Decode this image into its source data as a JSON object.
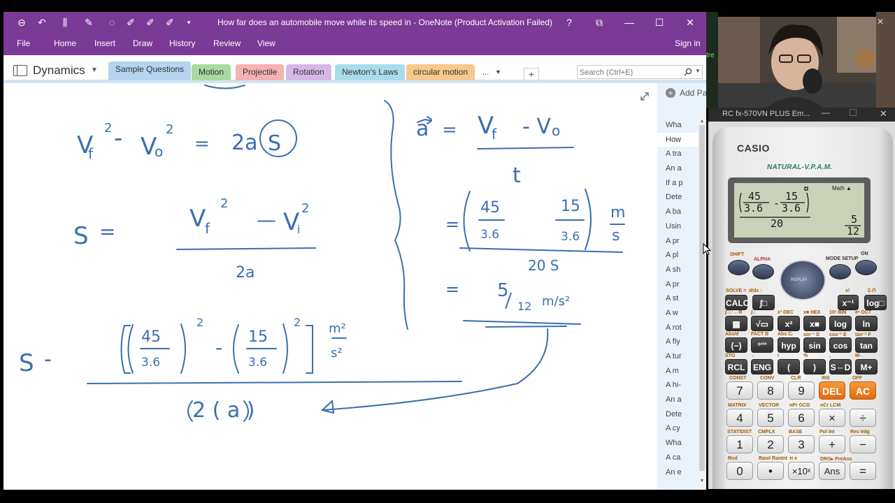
{
  "onenote": {
    "title": "How far does an automobile move while its speed in - OneNote (Product Activation Failed)",
    "help": "?",
    "menu": [
      "File",
      "Home",
      "Insert",
      "Draw",
      "History",
      "Review",
      "View"
    ],
    "sign_in": "Sign in",
    "notebook": "Dynamics",
    "sections": [
      {
        "label": "Sample Questions",
        "color": "#b4d4ef"
      },
      {
        "label": "Motion",
        "color": "#a8dba0"
      },
      {
        "label": "Projectile",
        "color": "#f6b2b2"
      },
      {
        "label": "Rotation",
        "color": "#d6b8e8"
      },
      {
        "label": "Newton's Laws",
        "color": "#a9dcea"
      },
      {
        "label": "circular motion",
        "color": "#f7c98a"
      }
    ],
    "more_sections": "...",
    "search_placeholder": "Search (Ctrl+E)",
    "add_page": "Add Pa",
    "pages": [
      "Wha",
      "How",
      "A tra",
      "An a",
      "If a p",
      "Dete",
      "A ba",
      "Usin",
      "A pr",
      "A pl",
      "A sh",
      "A pr",
      "A st",
      "A w",
      "A rot",
      "A fly",
      "A tur",
      "A m",
      "A hi-",
      "An a",
      "Dete",
      "A cy",
      "Wha",
      "A ca",
      "An e"
    ],
    "selected_page_index": 1,
    "ink_color": "#3a6fb0"
  },
  "ink": {
    "eq1": {
      "lhs": "V",
      "f": "f",
      "sq": "2",
      "minus": "-",
      "v0": "V",
      "zero": "o",
      "eq": "=",
      "rhs": "2a",
      "s": "S"
    },
    "eq2": {
      "s": "S",
      "eq": "=",
      "vf": "V",
      "f": "f",
      "sq": "2",
      "minus": "—",
      "vi": "V",
      "i": "i",
      "den": "2a"
    },
    "eq3": {
      "s": "S",
      "eq": "-",
      "n45": "45",
      "d36a": "3.6",
      "minus": "-",
      "n15": "15",
      "d36b": "3.6",
      "sq": "2",
      "unit_num": "m²",
      "unit_den": "s²",
      "den": "2 ( a )"
    },
    "right": {
      "a": "a",
      "eq": "=",
      "vf": "V",
      "f": "f",
      "minus": "- V",
      "zero": "o",
      "t": "t",
      "n45": "45",
      "d36": "3.6",
      "n15": "15",
      "m": "m",
      "s": "s",
      "mid_den": "20 S",
      "ans_num": "5",
      "ans_den": "12",
      "ans_unit": "m/s²"
    }
  },
  "webcam": {
    "side_text": "tre"
  },
  "calculator": {
    "window_title": "RC fx-570VN PLUS Em...",
    "brand": "CASIO",
    "model": "NATURAL-V.P.A.M.",
    "mode": "Math ▲",
    "lcd": {
      "n1": "45",
      "d1": "3.6",
      "op": "-",
      "n2": "15",
      "d2": "3.6",
      "den": "20",
      "res_num": "5",
      "res_den": "12"
    },
    "top_labels": {
      "shift": "SHIFT",
      "alpha": "ALPHA",
      "mode": "MODE SETUP",
      "on": "ON",
      "replay": "REPLAY"
    },
    "func_row1": [
      "CALC",
      "∫□",
      "x⁻¹",
      "log□"
    ],
    "func_row2": [
      "▦",
      "√▭",
      "x²",
      "x■",
      "log",
      "ln"
    ],
    "func_row3": [
      "(−)",
      "°'''",
      "hyp",
      "sin",
      "cos",
      "tan"
    ],
    "func_row4": [
      "RCL",
      "ENG",
      "(",
      ")",
      "S⇔D",
      "M+"
    ],
    "num_row1": [
      "7",
      "8",
      "9",
      "DEL",
      "AC"
    ],
    "num_row2": [
      "4",
      "5",
      "6",
      "×",
      "÷"
    ],
    "num_row3": [
      "1",
      "2",
      "3",
      "+",
      "−"
    ],
    "num_row4": [
      "0",
      "•",
      "×10ˣ",
      "Ans",
      "="
    ],
    "sub_labels": {
      "r1": [
        "SOLVE =",
        "d/dx :",
        "",
        "x!",
        "Σ-Π"
      ],
      "r2": [
        "∫□□ ←R",
        "∫□",
        "x³ DEC",
        "x■ HEX",
        "10ˣ BIN",
        "eˣ OCT"
      ],
      "r3": [
        "Abs/d",
        "FACT B",
        "Abs Cᵣ",
        "sin⁻¹ D",
        "cos⁻¹ E",
        "tan⁻¹ F"
      ],
      "r4": [
        "STO",
        "←",
        "i",
        "%",
        ",",
        "M-"
      ],
      "r5": [
        "CONST",
        "CONV",
        "CLR",
        "INS",
        "OFF"
      ],
      "r6": [
        "MATRIX",
        "VECTOR",
        "nPr GCD",
        "nCr LCM"
      ],
      "r7": [
        "STAT/DIST",
        "CMPLX",
        "BASE",
        "Pol Int",
        "Rec Intg"
      ],
      "r8": [
        "Rnd",
        "Ran# RanInt",
        "π e",
        "DRG▸ PreAns"
      ]
    }
  }
}
